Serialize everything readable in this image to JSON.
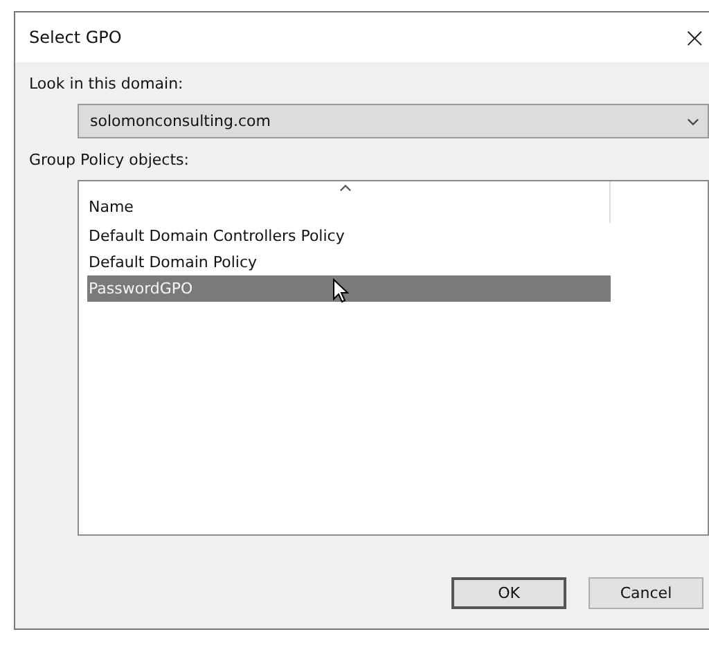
{
  "window": {
    "title": "Select GPO",
    "close": "×"
  },
  "domain": {
    "label": "Look in this domain:",
    "value": "solomonconsulting.com"
  },
  "gpo_list": {
    "label": "Group Policy objects:",
    "columns": [
      {
        "label": "Name",
        "sorted_ascending": true
      }
    ],
    "rows": [
      {
        "name": "Default Domain Controllers Policy",
        "selected": false
      },
      {
        "name": "Default Domain Policy",
        "selected": false
      },
      {
        "name": "PasswordGPO",
        "selected": true
      }
    ]
  },
  "buttons": [
    {
      "label": "OK",
      "default": true
    },
    {
      "label": "Cancel",
      "default": false
    }
  ]
}
